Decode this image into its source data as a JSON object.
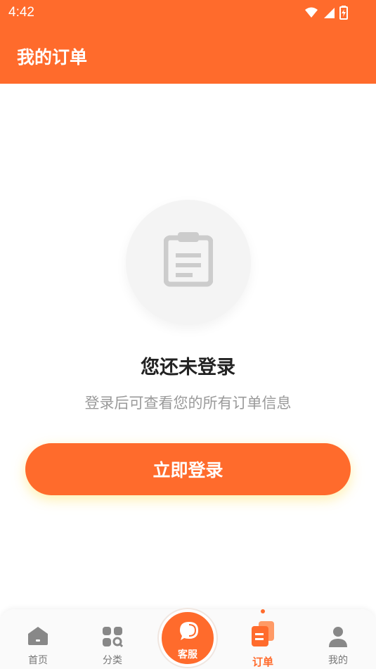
{
  "status_bar": {
    "time": "4:42",
    "icons": [
      "wifi-icon",
      "signal-icon",
      "battery-icon"
    ]
  },
  "header": {
    "title": "我的订单"
  },
  "empty_state": {
    "icon": "clipboard-icon",
    "title": "您还未登录",
    "description": "登录后可查看您的所有订单信息",
    "button_label": "立即登录"
  },
  "bottom_nav": {
    "items": [
      {
        "label": "首页",
        "icon": "home-icon",
        "active": false
      },
      {
        "label": "分类",
        "icon": "category-grid-icon",
        "active": false
      },
      {
        "label": "客服",
        "icon": "chat-bubble-icon",
        "active": false
      },
      {
        "label": "订单",
        "icon": "orders-icon",
        "active": true
      },
      {
        "label": "我的",
        "icon": "profile-icon",
        "active": false
      }
    ]
  },
  "colors": {
    "accent": "#ff6b2c",
    "background": "#ffffff",
    "muted_text": "#9a9a9a"
  }
}
